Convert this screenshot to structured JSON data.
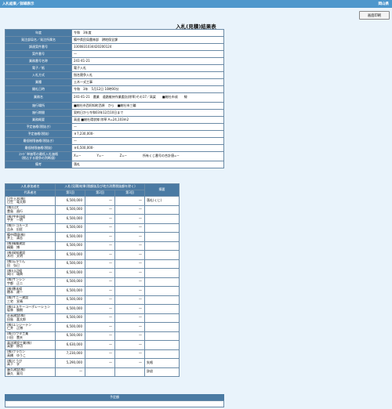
{
  "header": {
    "left": "入札結果／詳細表示",
    "right": "岡山県"
  },
  "print_button": "画面印刷",
  "page_title": "入札(見積)結果表",
  "info": [
    {
      "label": "年度",
      "value": "令和　3年度"
    },
    {
      "label": "発注部局名／発注所属名",
      "value": "備中県民局農林部　耕地保全課"
    },
    {
      "label": "調達案件番号",
      "value": "3300831034420200124"
    },
    {
      "label": "案件番号",
      "value": "—"
    },
    {
      "label": "業務番号名称",
      "value": "241-41-21"
    },
    {
      "label": "電子／紙",
      "value": "電子入札"
    },
    {
      "label": "入札方式",
      "value": "指名競争入札"
    },
    {
      "label": "業種",
      "value": "土木一式工事"
    },
    {
      "label": "開札日時",
      "value": "令和　3年　5月12日 10時00分"
    },
    {
      "label": "業務名",
      "value": "241-41-21　農業　道路維持作業委託(除草)その17／高梁　　■総社市成　　線"
    },
    {
      "label": "施行場所",
      "value": "■総社市西阿知町西原　から　■総社市三輪"
    },
    {
      "label": "施行期間",
      "value": "契約日から令和03年12月10日まで"
    },
    {
      "label": "業務概要",
      "value": "高速 ■総社環状線 除草 A=24,103m2"
    },
    {
      "label": "予定価格(税抜き)",
      "value": "—"
    },
    {
      "label": "予定価格(税抜)",
      "value": "￥7,230,000-"
    },
    {
      "label": "最低制限価格(税抜き)",
      "value": "—"
    },
    {
      "label": "最低制限価格(税抜)",
      "value": "￥6,500,000-"
    },
    {
      "label": "ｽﾗｲﾄﾞ単価等の最低入札価格\n(税込する競争の判断値)",
      "value": "X=−　　　　　Y=−　　　　　Z=−　　　　　所有くじ番号の合計値=−"
    },
    {
      "label": "備考",
      "value": "落札"
    }
  ],
  "bid_table": {
    "col_company": "入札参加者名",
    "col_bids": "入札(見積)結果(税額抜及び地方消費税抜額を除く)",
    "col_rep": "代表者名",
    "col_r1": "第1回",
    "col_r2": "第2回",
    "col_r3": "第3回",
    "col_remark": "摘要",
    "rows": [
      {
        "name": "日生土木(株)\n日生　竜太郎",
        "r1": "6,500,000",
        "r2": "—",
        "r3": "—",
        "remark": "落札(くじ)"
      },
      {
        "name": "(株)日大\n豊島　昌行",
        "r1": "6,500,000",
        "r2": "—",
        "r3": "—",
        "remark": ""
      },
      {
        "name": "(株)宇井田組\n宇井　一明",
        "r1": "6,500,000",
        "r2": "—",
        "r3": "—",
        "remark": ""
      },
      {
        "name": "(株)トコルーズ\n吉永　旧匠",
        "r1": "6,500,000",
        "r2": "—",
        "r3": "—",
        "remark": ""
      },
      {
        "name": "備中環境(株)\n井上　清志",
        "r1": "6,500,000",
        "r2": "—",
        "r3": "—",
        "remark": ""
      },
      {
        "name": "(株)精築建設\n精築　博",
        "r1": "6,500,000",
        "r2": "—",
        "r3": "—",
        "remark": ""
      },
      {
        "name": "(株)岡知建設\n木村　文明",
        "r1": "6,500,000",
        "r2": "—",
        "r3": "—",
        "remark": ""
      },
      {
        "name": "(株)ムラリん\n田　弘巳",
        "r1": "6,500,000",
        "r2": "—",
        "r3": "—",
        "remark": ""
      },
      {
        "name": "(株)山辺組\n岡川　瑞典",
        "r1": "6,500,000",
        "r2": "—",
        "r3": "—",
        "remark": ""
      },
      {
        "name": "(株)サンシン\n宇都　正二",
        "r1": "6,500,000",
        "r2": "—",
        "r3": "—",
        "remark": ""
      },
      {
        "name": "(株)穂本組\n穂本　建一",
        "r1": "6,500,000",
        "r2": "—",
        "r3": "—",
        "remark": ""
      },
      {
        "name": "(株)サニー建設\n三宅　宣晴",
        "r1": "6,500,000",
        "r2": "—",
        "r3": "—",
        "remark": ""
      },
      {
        "name": "(株)エスケーコーポレーション\n坂林　勝朗",
        "r1": "6,500,000",
        "r2": "—",
        "r3": "—",
        "remark": ""
      },
      {
        "name": "荘高建設(株)\n田島　喜太郎",
        "r1": "6,500,000",
        "r2": "—",
        "r3": "—",
        "remark": ""
      },
      {
        "name": "(株)エンジーテン\n仁井　正博",
        "r1": "6,500,000",
        "r2": "—",
        "r3": "—",
        "remark": ""
      },
      {
        "name": "(株)カワタ工業\n川田　豊夫",
        "r1": "6,500,000",
        "r2": "—",
        "r3": "—",
        "remark": ""
      },
      {
        "name": "高洋建設工業(株)\n高野　修功",
        "r1": "6,630,000",
        "r2": "—",
        "r3": "—",
        "remark": ""
      },
      {
        "name": "(株)クラカン\n高橋　ゆうこ",
        "r1": "7,230,000",
        "r2": "—",
        "r3": "—",
        "remark": ""
      },
      {
        "name": "(株)とうび\n高下　学",
        "r1": "5,290,000",
        "r2": "—",
        "r3": "—",
        "remark": "失格"
      },
      {
        "name": "藤久建設(株)\n藤久　寛司",
        "r1": "—",
        "r2": "",
        "r3": "",
        "remark": "辞退"
      }
    ]
  },
  "amount": {
    "title": "予定額",
    "value": ""
  }
}
